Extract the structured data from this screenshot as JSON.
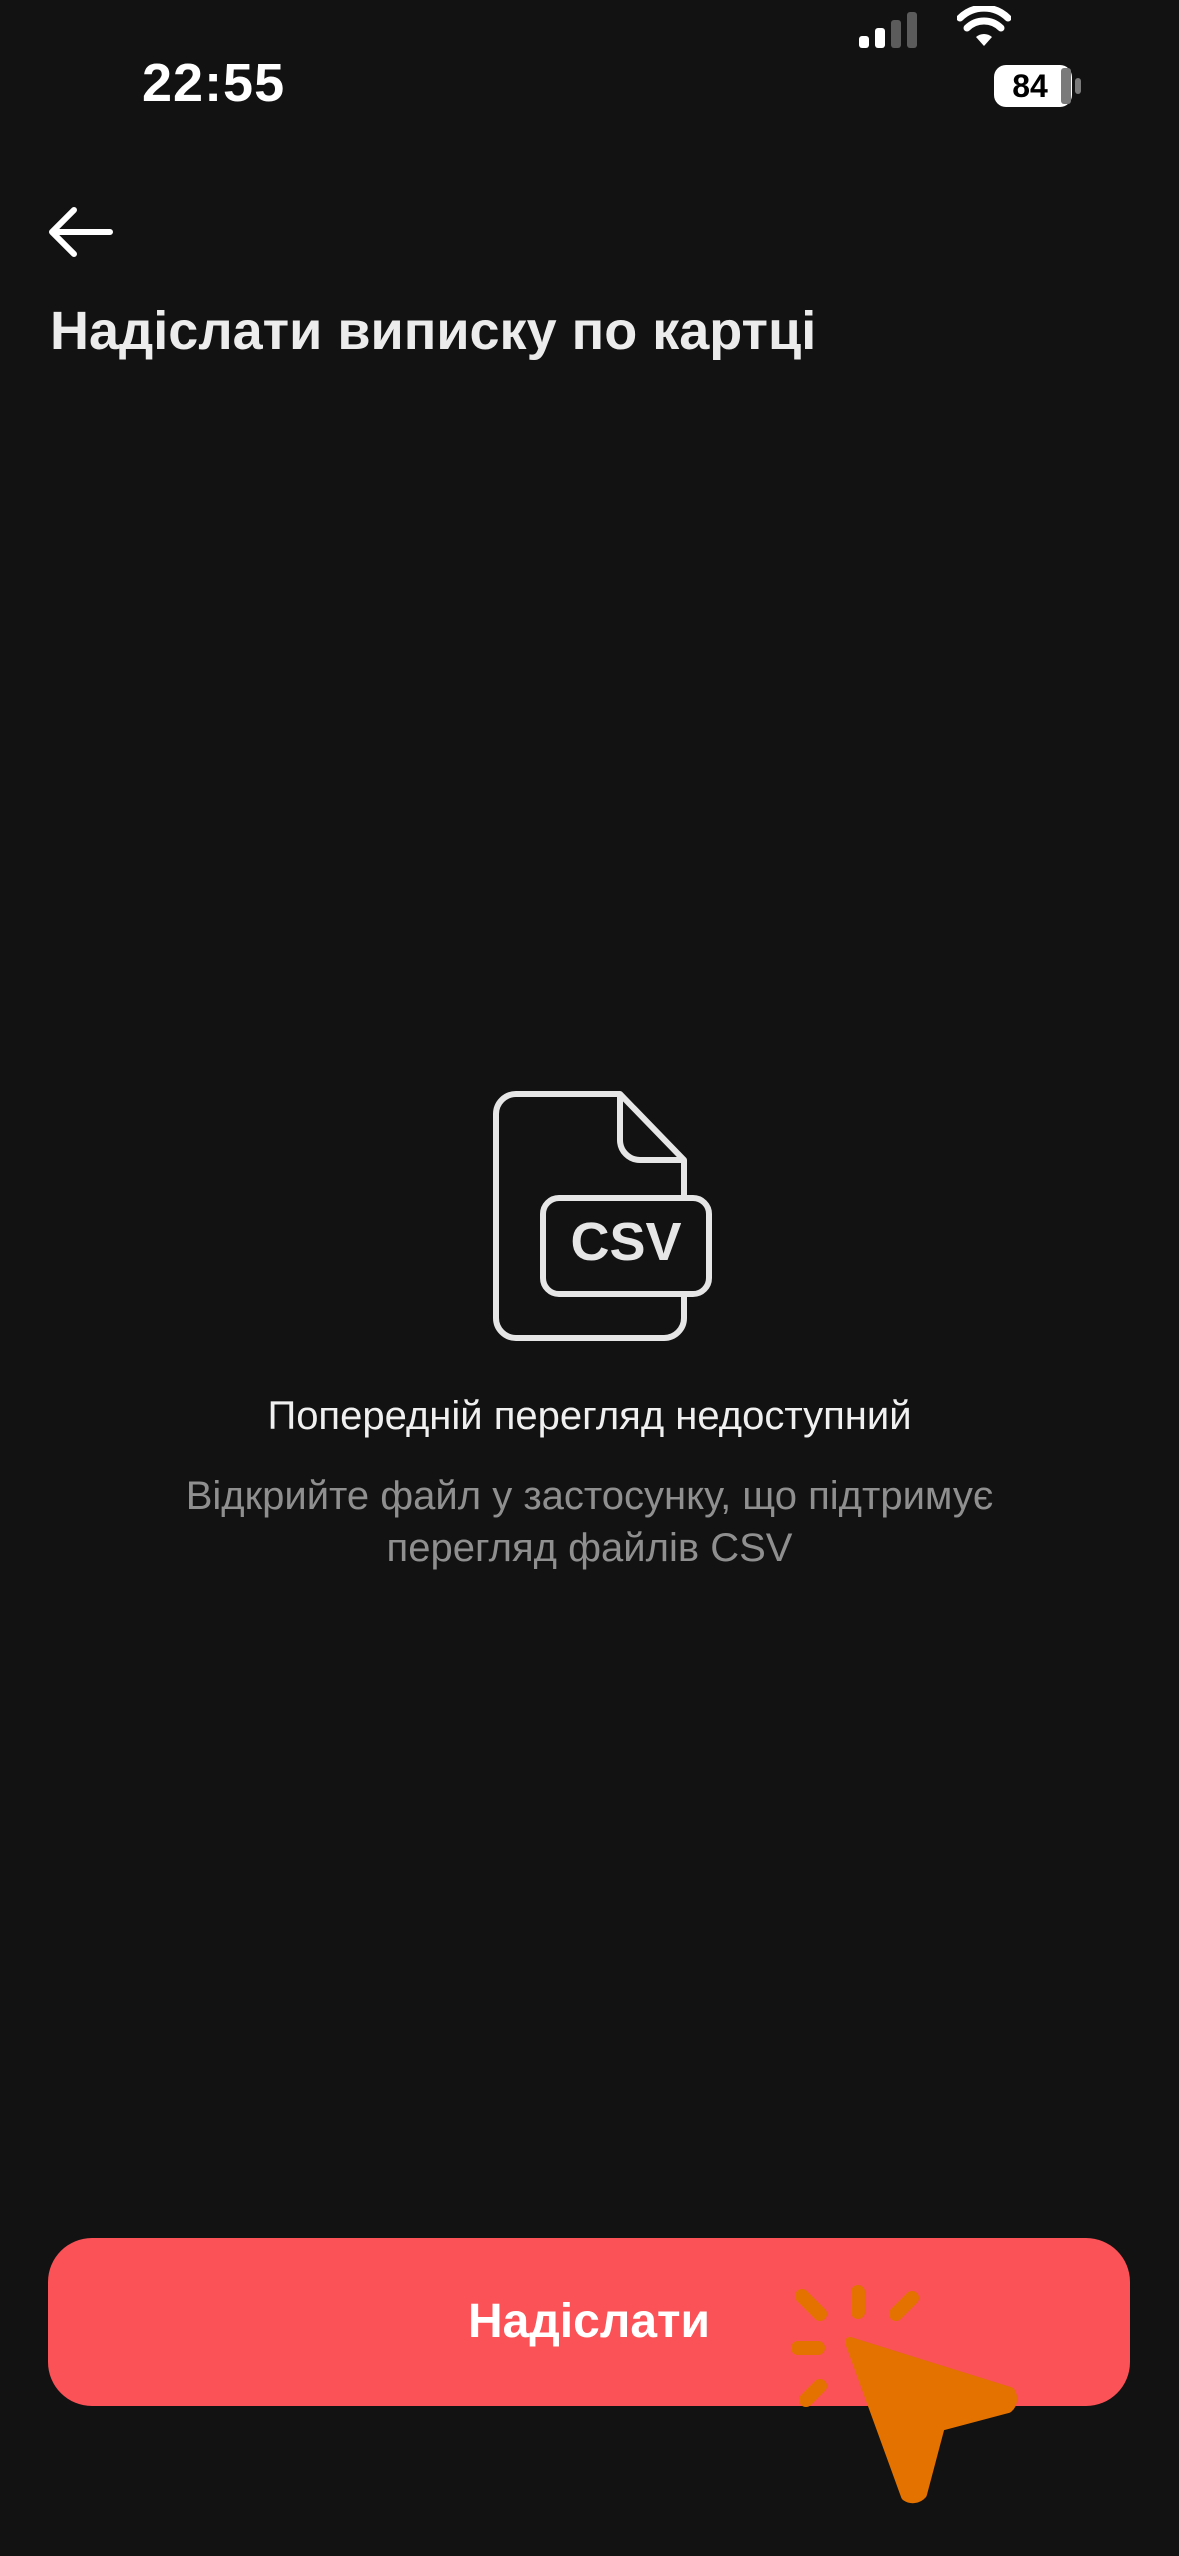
{
  "status_bar": {
    "time": "22:55",
    "battery": "84",
    "icons": [
      "signal-icon",
      "wifi-icon",
      "battery-icon"
    ]
  },
  "header": {
    "back_icon": "arrow-left-icon",
    "title": "Надіслати виписку по картці"
  },
  "preview": {
    "file_icon": "csv-file-icon",
    "file_badge": "CSV",
    "title": "Попередній перегляд недоступний",
    "subtitle": "Відкрийте файл у застосунку, що підтримує перегляд файлів CSV"
  },
  "actions": {
    "send_label": "Надіслати"
  },
  "colors": {
    "background": "#121212",
    "accent": "#fa5256",
    "cursor": "#e37200"
  }
}
